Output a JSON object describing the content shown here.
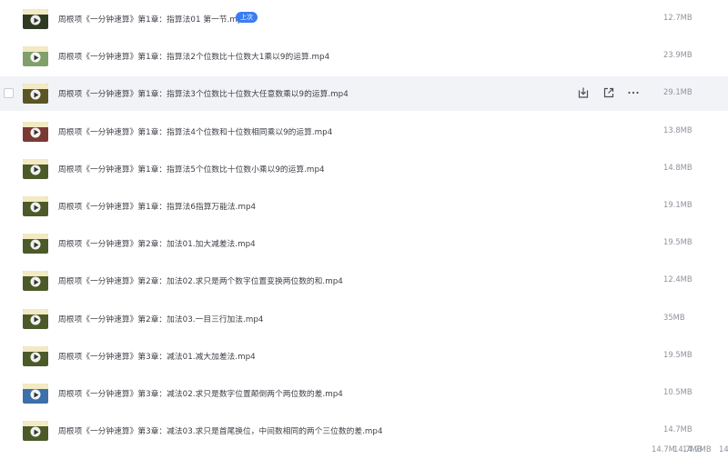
{
  "files": [
    {
      "name": "周根项《一分钟速算》第1章：指算法01 第一节.mp4",
      "size": "12.7MB",
      "badge": "上次",
      "thumb": "#2f3a22"
    },
    {
      "name": "周根项《一分钟速算》第1章：指算法2个位数比十位数大1乘以9的运算.mp4",
      "size": "23.9MB",
      "thumb": "#7fa06a"
    },
    {
      "name": "周根项《一分钟速算》第1章：指算法3个位数比十位数大任意数乘以9的运算.mp4",
      "size": "29.1MB",
      "thumb": "#5a5524",
      "hovered": true
    },
    {
      "name": "周根项《一分钟速算》第1章：指算法4个位数和十位数相同乘以9的运算.mp4",
      "size": "13.8MB",
      "thumb": "#7a3a34"
    },
    {
      "name": "周根项《一分钟速算》第1章：指算法5个位数比十位数小乘以9的运算.mp4",
      "size": "14.8MB",
      "thumb": "#4b5a28"
    },
    {
      "name": "周根项《一分钟速算》第1章：指算法6指算万能法.mp4",
      "size": "19.1MB",
      "thumb": "#4b5a28"
    },
    {
      "name": "周根项《一分钟速算》第2章：加法01.加大减差法.mp4",
      "size": "19.5MB",
      "thumb": "#4b5a28"
    },
    {
      "name": "周根项《一分钟速算》第2章：加法02.求只是两个数字位置变换两位数的和.mp4",
      "size": "12.4MB",
      "thumb": "#4b5a28"
    },
    {
      "name": "周根项《一分钟速算》第2章：加法03.一目三行加法.mp4",
      "size": "35MB",
      "thumb": "#4b5a28"
    },
    {
      "name": "周根项《一分钟速算》第3章：减法01.减大加差法.mp4",
      "size": "19.5MB",
      "thumb": "#4b5a28"
    },
    {
      "name": "周根项《一分钟速算》第3章：减法02.求只是数字位置颠倒两个两位数的差.mp4",
      "size": "10.5MB",
      "thumb": "#3d6fa8"
    },
    {
      "name": "周根项《一分钟速算》第3章：减法03.求只是首尾换位，中间数相同的两个三位数的差.mp4",
      "size": "14.7MB",
      "thumb": "#4b5a28"
    }
  ],
  "overflow_sizes": [
    "14.7M",
    "14.7MB",
    "14.7MB",
    "14."
  ],
  "hover_actions": [
    "download-icon",
    "share-icon",
    "more-icon"
  ]
}
